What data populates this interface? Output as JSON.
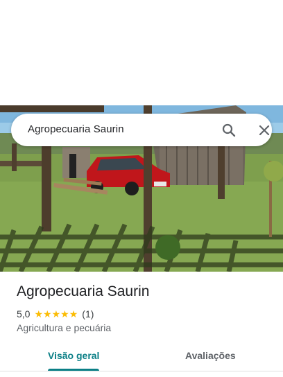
{
  "search": {
    "query": "Agropecuaria Saurin"
  },
  "place": {
    "name": "Agropecuaria Saurin",
    "rating": "5,0",
    "stars": 5,
    "review_count": "(1)",
    "category": "Agricultura e pecuária"
  },
  "tabs": [
    {
      "label": "Visão geral",
      "active": true
    },
    {
      "label": "Avaliações",
      "active": false
    }
  ],
  "colors": {
    "accent": "#0b7f86",
    "star": "#fbbc04"
  },
  "icons": [
    "search-icon",
    "close-icon",
    "star-icon"
  ]
}
